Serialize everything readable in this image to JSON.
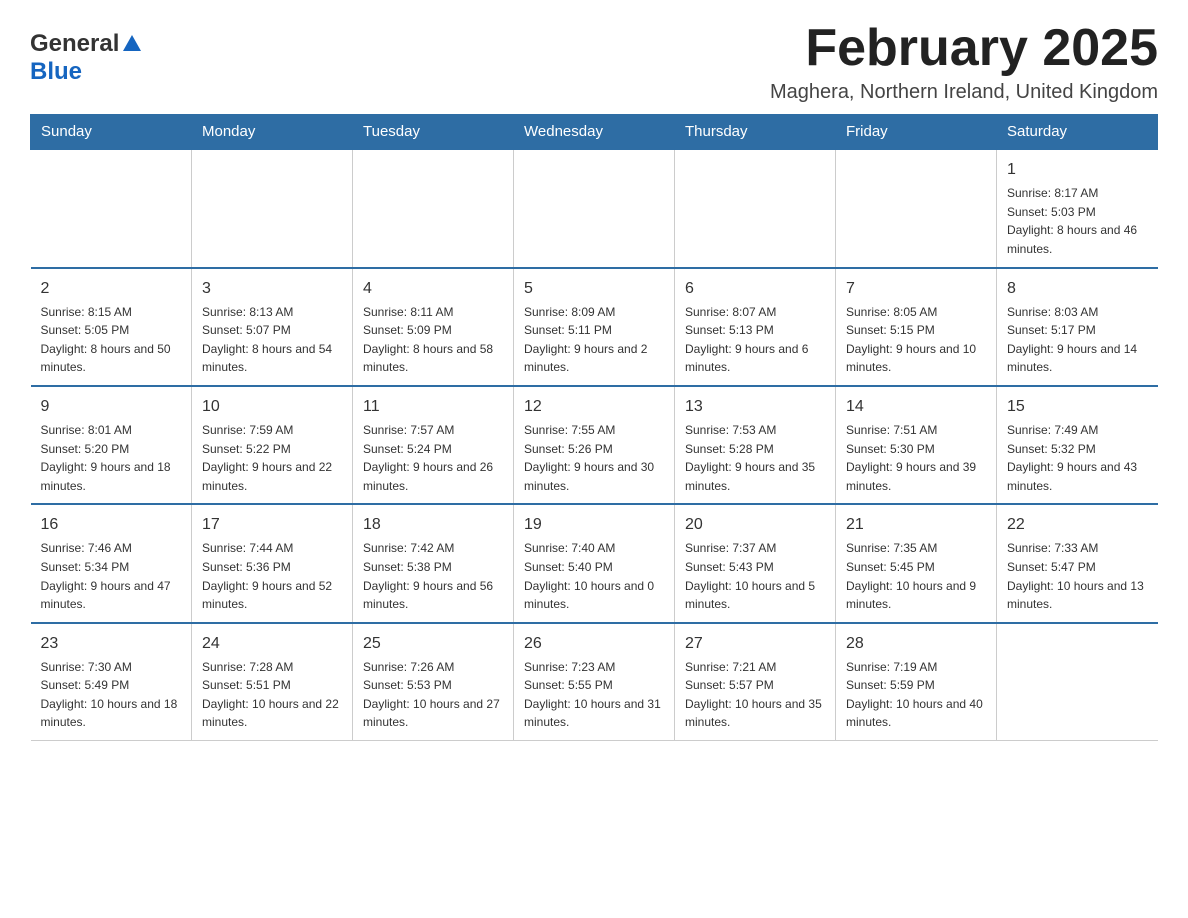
{
  "header": {
    "logo_general": "General",
    "logo_blue": "Blue",
    "month_title": "February 2025",
    "location": "Maghera, Northern Ireland, United Kingdom"
  },
  "days_of_week": [
    "Sunday",
    "Monday",
    "Tuesday",
    "Wednesday",
    "Thursday",
    "Friday",
    "Saturday"
  ],
  "weeks": [
    {
      "days": [
        {
          "number": "",
          "sunrise": "",
          "sunset": "",
          "daylight": ""
        },
        {
          "number": "",
          "sunrise": "",
          "sunset": "",
          "daylight": ""
        },
        {
          "number": "",
          "sunrise": "",
          "sunset": "",
          "daylight": ""
        },
        {
          "number": "",
          "sunrise": "",
          "sunset": "",
          "daylight": ""
        },
        {
          "number": "",
          "sunrise": "",
          "sunset": "",
          "daylight": ""
        },
        {
          "number": "",
          "sunrise": "",
          "sunset": "",
          "daylight": ""
        },
        {
          "number": "1",
          "sunrise": "Sunrise: 8:17 AM",
          "sunset": "Sunset: 5:03 PM",
          "daylight": "Daylight: 8 hours and 46 minutes."
        }
      ]
    },
    {
      "days": [
        {
          "number": "2",
          "sunrise": "Sunrise: 8:15 AM",
          "sunset": "Sunset: 5:05 PM",
          "daylight": "Daylight: 8 hours and 50 minutes."
        },
        {
          "number": "3",
          "sunrise": "Sunrise: 8:13 AM",
          "sunset": "Sunset: 5:07 PM",
          "daylight": "Daylight: 8 hours and 54 minutes."
        },
        {
          "number": "4",
          "sunrise": "Sunrise: 8:11 AM",
          "sunset": "Sunset: 5:09 PM",
          "daylight": "Daylight: 8 hours and 58 minutes."
        },
        {
          "number": "5",
          "sunrise": "Sunrise: 8:09 AM",
          "sunset": "Sunset: 5:11 PM",
          "daylight": "Daylight: 9 hours and 2 minutes."
        },
        {
          "number": "6",
          "sunrise": "Sunrise: 8:07 AM",
          "sunset": "Sunset: 5:13 PM",
          "daylight": "Daylight: 9 hours and 6 minutes."
        },
        {
          "number": "7",
          "sunrise": "Sunrise: 8:05 AM",
          "sunset": "Sunset: 5:15 PM",
          "daylight": "Daylight: 9 hours and 10 minutes."
        },
        {
          "number": "8",
          "sunrise": "Sunrise: 8:03 AM",
          "sunset": "Sunset: 5:17 PM",
          "daylight": "Daylight: 9 hours and 14 minutes."
        }
      ]
    },
    {
      "days": [
        {
          "number": "9",
          "sunrise": "Sunrise: 8:01 AM",
          "sunset": "Sunset: 5:20 PM",
          "daylight": "Daylight: 9 hours and 18 minutes."
        },
        {
          "number": "10",
          "sunrise": "Sunrise: 7:59 AM",
          "sunset": "Sunset: 5:22 PM",
          "daylight": "Daylight: 9 hours and 22 minutes."
        },
        {
          "number": "11",
          "sunrise": "Sunrise: 7:57 AM",
          "sunset": "Sunset: 5:24 PM",
          "daylight": "Daylight: 9 hours and 26 minutes."
        },
        {
          "number": "12",
          "sunrise": "Sunrise: 7:55 AM",
          "sunset": "Sunset: 5:26 PM",
          "daylight": "Daylight: 9 hours and 30 minutes."
        },
        {
          "number": "13",
          "sunrise": "Sunrise: 7:53 AM",
          "sunset": "Sunset: 5:28 PM",
          "daylight": "Daylight: 9 hours and 35 minutes."
        },
        {
          "number": "14",
          "sunrise": "Sunrise: 7:51 AM",
          "sunset": "Sunset: 5:30 PM",
          "daylight": "Daylight: 9 hours and 39 minutes."
        },
        {
          "number": "15",
          "sunrise": "Sunrise: 7:49 AM",
          "sunset": "Sunset: 5:32 PM",
          "daylight": "Daylight: 9 hours and 43 minutes."
        }
      ]
    },
    {
      "days": [
        {
          "number": "16",
          "sunrise": "Sunrise: 7:46 AM",
          "sunset": "Sunset: 5:34 PM",
          "daylight": "Daylight: 9 hours and 47 minutes."
        },
        {
          "number": "17",
          "sunrise": "Sunrise: 7:44 AM",
          "sunset": "Sunset: 5:36 PM",
          "daylight": "Daylight: 9 hours and 52 minutes."
        },
        {
          "number": "18",
          "sunrise": "Sunrise: 7:42 AM",
          "sunset": "Sunset: 5:38 PM",
          "daylight": "Daylight: 9 hours and 56 minutes."
        },
        {
          "number": "19",
          "sunrise": "Sunrise: 7:40 AM",
          "sunset": "Sunset: 5:40 PM",
          "daylight": "Daylight: 10 hours and 0 minutes."
        },
        {
          "number": "20",
          "sunrise": "Sunrise: 7:37 AM",
          "sunset": "Sunset: 5:43 PM",
          "daylight": "Daylight: 10 hours and 5 minutes."
        },
        {
          "number": "21",
          "sunrise": "Sunrise: 7:35 AM",
          "sunset": "Sunset: 5:45 PM",
          "daylight": "Daylight: 10 hours and 9 minutes."
        },
        {
          "number": "22",
          "sunrise": "Sunrise: 7:33 AM",
          "sunset": "Sunset: 5:47 PM",
          "daylight": "Daylight: 10 hours and 13 minutes."
        }
      ]
    },
    {
      "days": [
        {
          "number": "23",
          "sunrise": "Sunrise: 7:30 AM",
          "sunset": "Sunset: 5:49 PM",
          "daylight": "Daylight: 10 hours and 18 minutes."
        },
        {
          "number": "24",
          "sunrise": "Sunrise: 7:28 AM",
          "sunset": "Sunset: 5:51 PM",
          "daylight": "Daylight: 10 hours and 22 minutes."
        },
        {
          "number": "25",
          "sunrise": "Sunrise: 7:26 AM",
          "sunset": "Sunset: 5:53 PM",
          "daylight": "Daylight: 10 hours and 27 minutes."
        },
        {
          "number": "26",
          "sunrise": "Sunrise: 7:23 AM",
          "sunset": "Sunset: 5:55 PM",
          "daylight": "Daylight: 10 hours and 31 minutes."
        },
        {
          "number": "27",
          "sunrise": "Sunrise: 7:21 AM",
          "sunset": "Sunset: 5:57 PM",
          "daylight": "Daylight: 10 hours and 35 minutes."
        },
        {
          "number": "28",
          "sunrise": "Sunrise: 7:19 AM",
          "sunset": "Sunset: 5:59 PM",
          "daylight": "Daylight: 10 hours and 40 minutes."
        },
        {
          "number": "",
          "sunrise": "",
          "sunset": "",
          "daylight": ""
        }
      ]
    }
  ]
}
